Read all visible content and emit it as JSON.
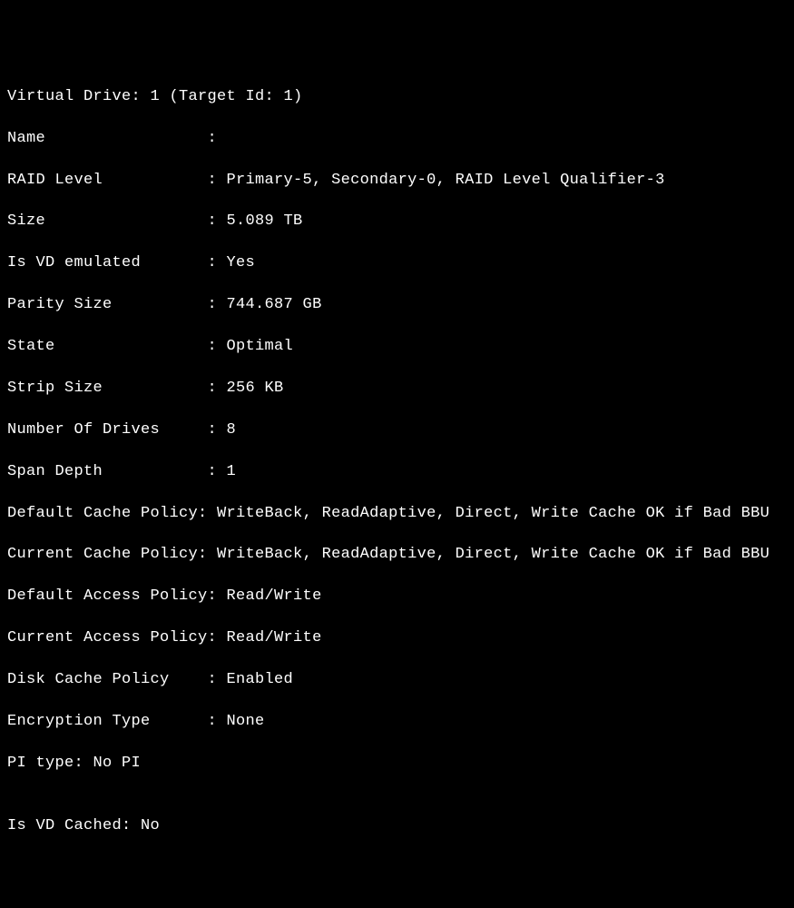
{
  "terminal": {
    "header": "Virtual Drive: 1 (Target Id: 1)",
    "lines_padded": [
      {
        "label": "Name                 :",
        "value": ""
      },
      {
        "label": "RAID Level           :",
        "value": " Primary-5, Secondary-0, RAID Level Qualifier-3"
      },
      {
        "label": "Size                 :",
        "value": " 5.089 TB"
      },
      {
        "label": "Is VD emulated       :",
        "value": " Yes"
      },
      {
        "label": "Parity Size          :",
        "value": " 744.687 GB"
      },
      {
        "label": "State                :",
        "value": " Optimal"
      },
      {
        "label": "Strip Size           :",
        "value": " 256 KB"
      },
      {
        "label": "Number Of Drives     :",
        "value": " 8"
      },
      {
        "label": "Span Depth           :",
        "value": " 1"
      },
      {
        "label": "Default Cache Policy:",
        "value": " WriteBack, ReadAdaptive, Direct, Write Cache OK if Bad BBU"
      },
      {
        "label": "Current Cache Policy:",
        "value": " WriteBack, ReadAdaptive, Direct, Write Cache OK if Bad BBU"
      },
      {
        "label": "Default Access Policy:",
        "value": " Read/Write"
      },
      {
        "label": "Current Access Policy:",
        "value": " Read/Write"
      },
      {
        "label": "Disk Cache Policy    :",
        "value": " Enabled"
      },
      {
        "label": "Encryption Type      :",
        "value": " None"
      },
      {
        "label": "PI type:",
        "value": " No PI"
      }
    ],
    "blank": "",
    "footer": "Is VD Cached: No"
  }
}
